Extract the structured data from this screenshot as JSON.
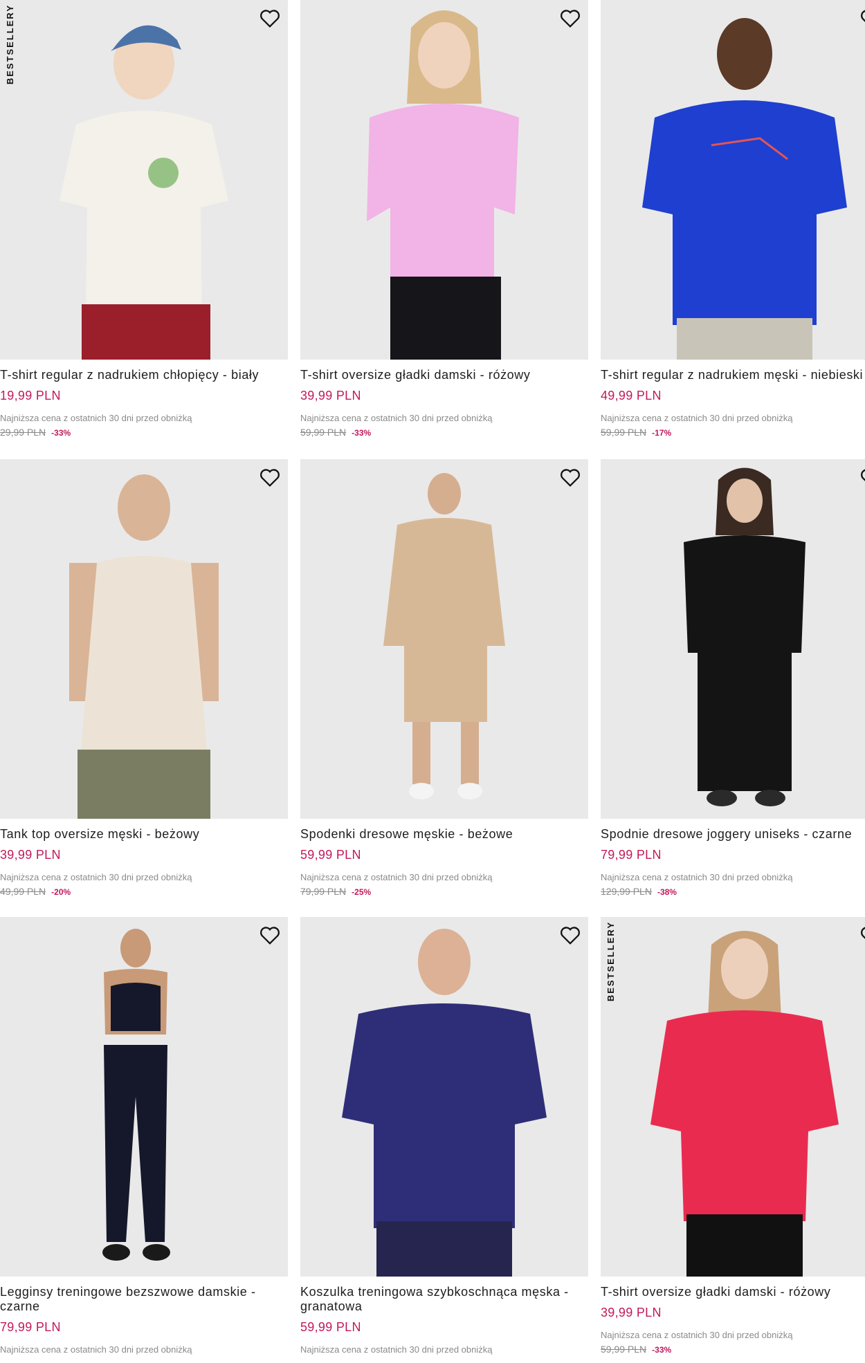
{
  "colors": {
    "accent": "#c2185b",
    "image_bg": "#e9e9e9",
    "muted": "#8a8a8a"
  },
  "products": [
    {
      "name": "T-shirt regular z nadrukiem chłopięcy - biały",
      "price": "19,99 PLN",
      "lowest_label": "Najniższa cena z ostatnich 30 dni przed obniżką",
      "old_price": "29,99 PLN",
      "discount": "-33%",
      "badge": "BESTSELLERY",
      "garment_color": "#f4f1ea",
      "icon": "heart-icon"
    },
    {
      "name": "T-shirt oversize gładki damski - różowy",
      "price": "39,99 PLN",
      "lowest_label": "Najniższa cena z ostatnich 30 dni przed obniżką",
      "old_price": "59,99 PLN",
      "discount": "-33%",
      "garment_color": "#f2b3e6",
      "icon": "heart-icon"
    },
    {
      "name": "T-shirt regular z nadrukiem męski - niebieski",
      "price": "49,99 PLN",
      "lowest_label": "Najniższa cena z ostatnich 30 dni przed obniżką",
      "old_price": "59,99 PLN",
      "discount": "-17%",
      "garment_color": "#1f3fd0",
      "icon": "heart-icon"
    },
    {
      "name": "Tank top oversize męski - beżowy",
      "price": "39,99 PLN",
      "lowest_label": "Najniższa cena z ostatnich 30 dni przed obniżką",
      "old_price": "49,99 PLN",
      "discount": "-20%",
      "garment_color": "#ece3d6",
      "icon": "heart-icon"
    },
    {
      "name": "Spodenki dresowe męskie - beżowe",
      "price": "59,99 PLN",
      "lowest_label": "Najniższa cena z ostatnich 30 dni przed obniżką",
      "old_price": "79,99 PLN",
      "discount": "-25%",
      "garment_color": "#d7b896",
      "icon": "heart-icon"
    },
    {
      "name": "Spodnie dresowe joggery uniseks - czarne",
      "price": "79,99 PLN",
      "lowest_label": "Najniższa cena z ostatnich 30 dni przed obniżką",
      "old_price": "129,99 PLN",
      "discount": "-38%",
      "garment_color": "#141414",
      "icon": "heart-icon"
    },
    {
      "name": "Legginsy treningowe bezszwowe damskie - czarne",
      "price": "79,99 PLN",
      "lowest_label": "Najniższa cena z ostatnich 30 dni przed obniżką",
      "garment_color": "#15182a",
      "icon": "heart-icon"
    },
    {
      "name": "Koszulka treningowa szybkoschnąca męska - granatowa",
      "price": "59,99 PLN",
      "lowest_label": "Najniższa cena z ostatnich 30 dni przed obniżką",
      "garment_color": "#2e2e78",
      "icon": "heart-icon"
    },
    {
      "name": "T-shirt oversize gładki damski - różowy",
      "price": "39,99 PLN",
      "lowest_label": "Najniższa cena z ostatnich 30 dni przed obniżką",
      "old_price": "59,99 PLN",
      "discount": "-33%",
      "badge": "BESTSELLERY",
      "garment_color": "#ea2b50",
      "icon": "heart-icon"
    }
  ]
}
